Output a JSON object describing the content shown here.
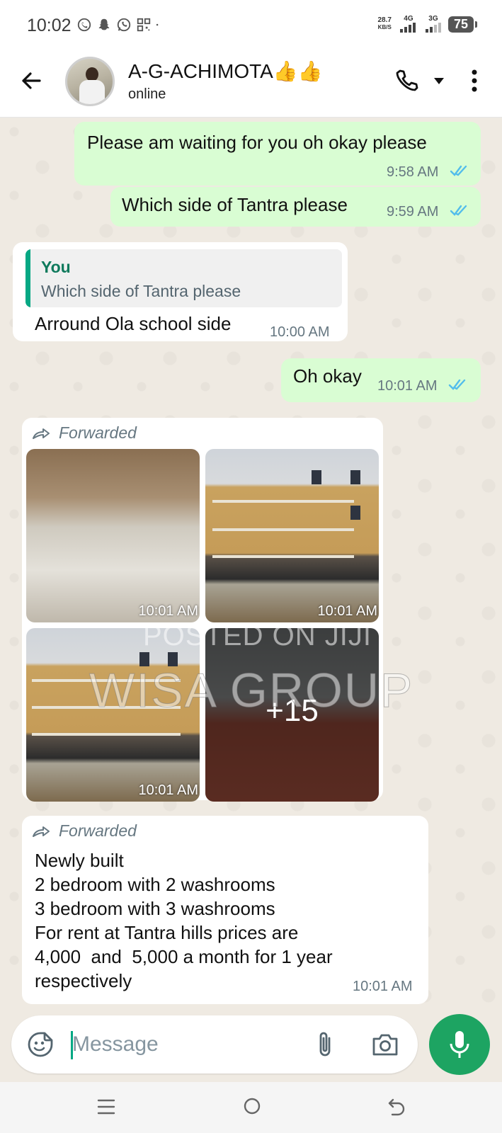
{
  "status_bar": {
    "time": "10:02",
    "net_speed_value": "28.7",
    "net_speed_unit": "KB/S",
    "sim1": "4G",
    "sim2": "3G",
    "battery": "75"
  },
  "header": {
    "contact_name": "A-G-ACHIMOTA👍👍",
    "status": "online"
  },
  "messages": [
    {
      "direction": "outgoing",
      "text": "Please am waiting for you oh okay please",
      "time": "9:58 AM",
      "read": true
    },
    {
      "direction": "outgoing",
      "text": "Which side of Tantra please",
      "time": "9:59 AM",
      "read": true
    },
    {
      "direction": "incoming",
      "quote_author": "You",
      "quote_text": "Which side of Tantra please",
      "text": "Arround Ola school side",
      "time": "10:00 AM"
    },
    {
      "direction": "outgoing",
      "text": "Oh okay",
      "time": "10:01 AM",
      "read": true
    },
    {
      "direction": "incoming",
      "forwarded_label": "Forwarded",
      "type": "photo_album",
      "photos": [
        {
          "time": "10:01 AM"
        },
        {
          "time": "10:01 AM"
        },
        {
          "time": "10:01 AM"
        },
        {
          "more": "+15"
        }
      ]
    },
    {
      "direction": "incoming",
      "forwarded_label": "Forwarded",
      "lines": [
        "Newly built",
        "2 bedroom with 2 washrooms",
        "3 bedroom with 3 washrooms",
        "For rent at Tantra hills prices are",
        "4,000  and  5,000 a month for 1 year",
        "respectively"
      ],
      "time": "10:01 AM"
    }
  ],
  "watermark": {
    "line1": "POSTED ON JIJI",
    "line2": "WISA GROUP"
  },
  "composer": {
    "placeholder": "Message"
  },
  "colors": {
    "outgoing_bubble": "#d9fdd3",
    "incoming_bubble": "#ffffff",
    "chat_background": "#efeae2",
    "accent_green": "#1da462",
    "read_tick_blue": "#53bdeb"
  }
}
